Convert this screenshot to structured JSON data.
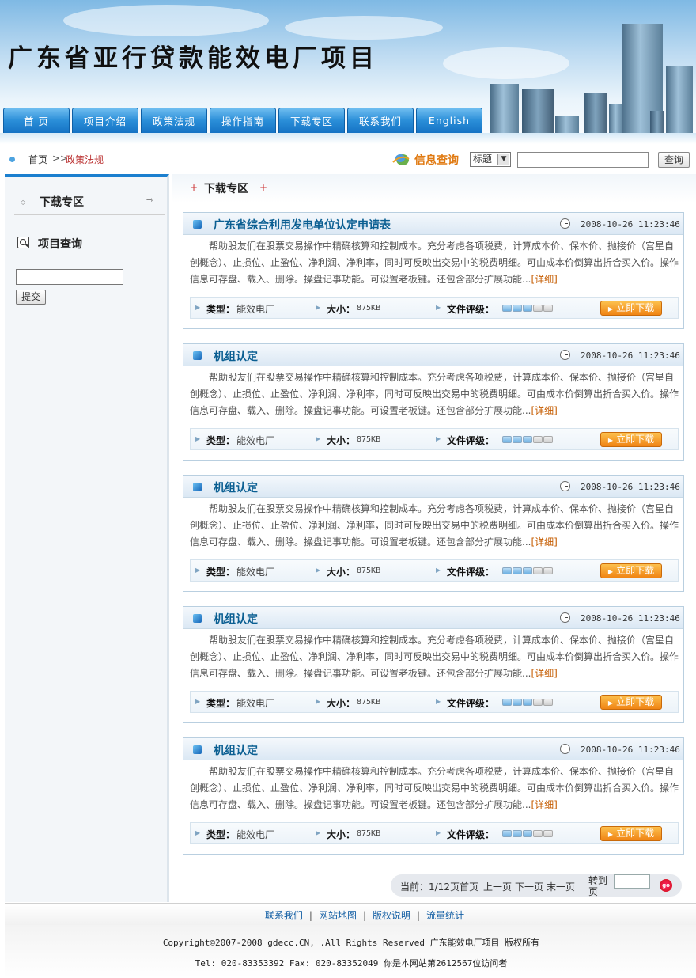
{
  "site": {
    "title": "广东省亚行贷款能效电厂项目"
  },
  "nav": [
    "首 页",
    "项目介绍",
    "政策法规",
    "操作指南",
    "下载专区",
    "联系我们",
    "English"
  ],
  "breadcrumb": {
    "home": "首页",
    "separator": ">>",
    "current": "政策法规"
  },
  "search": {
    "label": "信息查询",
    "select_value": "标题",
    "button": "查询"
  },
  "sidebar": {
    "download_label": "下载专区",
    "query_label": "项目查询",
    "submit": "提交"
  },
  "section_title": "下载专区",
  "items": [
    {
      "title": "广东省综合利用发电单位认定申请表",
      "date": "2008-10-26 11:23:46",
      "desc": "帮助股友们在股票交易操作中精确核算和控制成本。充分考虑各项税费，计算成本价、保本价、抛接价（宫星自创概念）、止损位、止盈位、净利润、净利率，同时可反映出交易中的税费明细。可由成本价倒算出折合买入价。操作信息可存盘、载入、删除。操盘记事功能。可设置老板键。还包含部分扩展功能...",
      "more": "[详细]",
      "type_label": "类型：",
      "type": "能效电厂",
      "size_label": "大小：",
      "size": "875KB",
      "rating_label": "文件评级：",
      "rating": 3,
      "rating_max": 5,
      "download": "立即下载"
    },
    {
      "title": "机组认定",
      "date": "2008-10-26 11:23:46",
      "desc": "帮助股友们在股票交易操作中精确核算和控制成本。充分考虑各项税费，计算成本价、保本价、抛接价（宫星自创概念）、止损位、止盈位、净利润、净利率，同时可反映出交易中的税费明细。可由成本价倒算出折合买入价。操作信息可存盘、载入、删除。操盘记事功能。可设置老板键。还包含部分扩展功能...",
      "more": "[详细]",
      "type_label": "类型：",
      "type": "能效电厂",
      "size_label": "大小：",
      "size": "875KB",
      "rating_label": "文件评级：",
      "rating": 3,
      "rating_max": 5,
      "download": "立即下载"
    },
    {
      "title": "机组认定",
      "date": "2008-10-26 11:23:46",
      "desc": "帮助股友们在股票交易操作中精确核算和控制成本。充分考虑各项税费，计算成本价、保本价、抛接价（宫星自创概念）、止损位、止盈位、净利润、净利率，同时可反映出交易中的税费明细。可由成本价倒算出折合买入价。操作信息可存盘、载入、删除。操盘记事功能。可设置老板键。还包含部分扩展功能...",
      "more": "[详细]",
      "type_label": "类型：",
      "type": "能效电厂",
      "size_label": "大小：",
      "size": "875KB",
      "rating_label": "文件评级：",
      "rating": 3,
      "rating_max": 5,
      "download": "立即下载"
    },
    {
      "title": "机组认定",
      "date": "2008-10-26 11:23:46",
      "desc": "帮助股友们在股票交易操作中精确核算和控制成本。充分考虑各项税费，计算成本价、保本价、抛接价（宫星自创概念）、止损位、止盈位、净利润、净利率，同时可反映出交易中的税费明细。可由成本价倒算出折合买入价。操作信息可存盘、载入、删除。操盘记事功能。可设置老板键。还包含部分扩展功能...",
      "more": "[详细]",
      "type_label": "类型：",
      "type": "能效电厂",
      "size_label": "大小：",
      "size": "875KB",
      "rating_label": "文件评级：",
      "rating": 3,
      "rating_max": 5,
      "download": "立即下载"
    },
    {
      "title": "机组认定",
      "date": "2008-10-26 11:23:46",
      "desc": "帮助股友们在股票交易操作中精确核算和控制成本。充分考虑各项税费，计算成本价、保本价、抛接价（宫星自创概念）、止损位、止盈位、净利润、净利率，同时可反映出交易中的税费明细。可由成本价倒算出折合买入价。操作信息可存盘、载入、删除。操盘记事功能。可设置老板键。还包含部分扩展功能...",
      "more": "[详细]",
      "type_label": "类型：",
      "type": "能效电厂",
      "size_label": "大小：",
      "size": "875KB",
      "rating_label": "文件评级：",
      "rating": 3,
      "rating_max": 5,
      "download": "立即下载"
    }
  ],
  "pager": {
    "current": "当前：1/12页",
    "first": "首页",
    "prev": "上一页",
    "next": "下一页",
    "last": "末一页",
    "goto": "转到页",
    "go": "go"
  },
  "footer": {
    "links": [
      "联系我们",
      "网站地图",
      "版权说明",
      "流量统计"
    ],
    "link_separator": "|",
    "copyright": "Copyright©2007-2008 gdecc.CN, .All Rights Reserved 广东能效电厂项目 版权所有",
    "contact": "Tel: 020-83353392 Fax: 020-83352049 你是本网站第2612567位访问者"
  },
  "colors": {
    "nav_blue": "#1b7fcf",
    "title_blue": "#0b5f92",
    "accent_orange": "#f08414",
    "crumb_red": "#b33"
  }
}
